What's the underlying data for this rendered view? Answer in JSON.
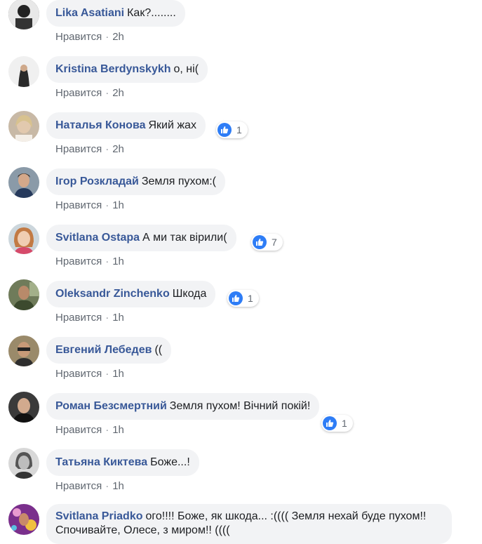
{
  "like_label": "Нравится",
  "comments": [
    {
      "author": "Lika Asatiani",
      "text": "Как?........",
      "time": "2h",
      "reactions": null
    },
    {
      "author": "Kristina Berdynskykh",
      "text": "о, ні(",
      "time": "2h",
      "reactions": null
    },
    {
      "author": "Наталья Конова",
      "text": "Який жах",
      "time": "2h",
      "reactions": "1"
    },
    {
      "author": "Ігор Розкладай",
      "text": "Земля пухом:(",
      "time": "1h",
      "reactions": null
    },
    {
      "author": "Svitlana Ostapa",
      "text": "А ми так вірили(",
      "time": "1h",
      "reactions": "7"
    },
    {
      "author": "Oleksandr Zinchenko",
      "text": "Шкода",
      "time": "1h",
      "reactions": "1"
    },
    {
      "author": "Евгений Лебедев",
      "text": "((",
      "time": "1h",
      "reactions": null
    },
    {
      "author": "Роман Безсмертний",
      "text": "Земля пухом! Вічний покій!",
      "time": "1h",
      "reactions": "1"
    },
    {
      "author": "Татьяна Киктева",
      "text": "Боже...!",
      "time": "1h",
      "reactions": null
    },
    {
      "author": "Svitlana Priadko",
      "text": "ого!!!! Боже, як шкода... :(((( Земля нехай буде пухом!! Спочивайте, Олесе, з миром!! ((((",
      "time": "",
      "reactions": null
    }
  ],
  "colors": {
    "author": "#385898",
    "bubble": "#f2f3f5",
    "like_blue": "#2e7df6"
  }
}
